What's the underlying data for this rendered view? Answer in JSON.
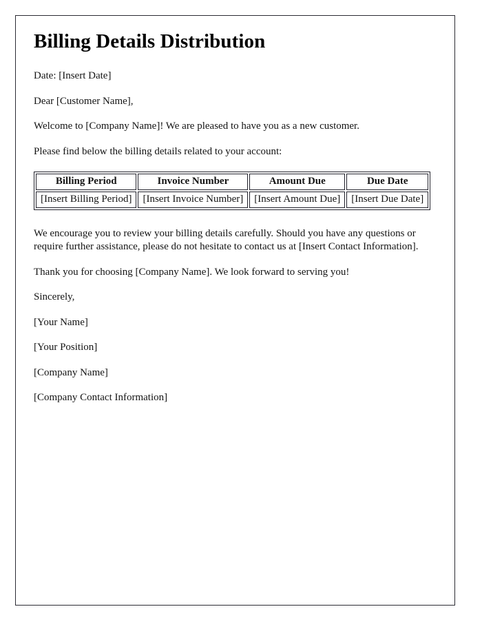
{
  "document": {
    "title": "Billing Details Distribution",
    "date_line": "Date: [Insert Date]",
    "salutation": "Dear [Customer Name],",
    "welcome_paragraph": "Welcome to [Company Name]! We are pleased to have you as a new customer.",
    "intro_paragraph": "Please find below the billing details related to your account:",
    "review_paragraph": "We encourage you to review your billing details carefully. Should you have any questions or require further assistance, please do not hesitate to contact us at [Insert Contact Information].",
    "thanks_paragraph": "Thank you for choosing [Company Name]. We look forward to serving you!",
    "closing": "Sincerely,",
    "signature": {
      "name": "[Your Name]",
      "position": "[Your Position]",
      "company": "[Company Name]",
      "contact": "[Company Contact Information]"
    }
  },
  "billing_table": {
    "headers": [
      "Billing Period",
      "Invoice Number",
      "Amount Due",
      "Due Date"
    ],
    "rows": [
      [
        "[Insert Billing Period]",
        "[Insert Invoice Number]",
        "[Insert Amount Due]",
        "[Insert Due Date]"
      ]
    ]
  },
  "colors": {
    "page_background": "#ffffff",
    "page_border": "#2b2b33",
    "text": "#141414",
    "title_text": "#000000",
    "table_border": "#20202a"
  }
}
